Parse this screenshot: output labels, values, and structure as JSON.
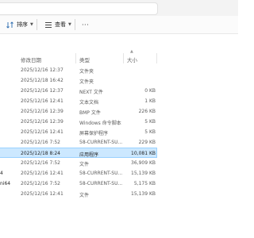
{
  "toolbar": {
    "sort_label": "排序",
    "view_label": "查看",
    "more_label": "···"
  },
  "header": {
    "date": "修改日期",
    "type": "类型",
    "size": "大小"
  },
  "rows": [
    {
      "frag": "",
      "date": "2025/12/16 12:37",
      "type": "文件夹",
      "size": ""
    },
    {
      "frag": "",
      "date": "2025/12/18 16:42",
      "type": "文件夹",
      "size": ""
    },
    {
      "frag": "",
      "date": "2025/12/16 12:37",
      "type": "NEXT 文件",
      "size": "0 KB"
    },
    {
      "frag": "",
      "date": "2025/12/16 12:41",
      "type": "文本文档",
      "size": "1 KB"
    },
    {
      "frag": "",
      "date": "2025/12/16 12:39",
      "type": "BMP 文件",
      "size": "226 KB"
    },
    {
      "frag": "",
      "date": "2025/12/16 12:39",
      "type": "Windows 命令脚本",
      "size": "5 KB"
    },
    {
      "frag": "",
      "date": "2025/12/16 12:41",
      "type": "屏幕保护程序",
      "size": "5 KB"
    },
    {
      "frag": "",
      "date": "2025/12/16 7:52",
      "type": "58-CURRENT-SU...",
      "size": "229 KB"
    },
    {
      "frag": "",
      "date": "2025/12/18 8:24",
      "type": "应用程序",
      "size": "10,081 KB",
      "selected": true
    },
    {
      "frag": "",
      "date": "2025/12/16 7:52",
      "type": "文件",
      "size": "36,909 KB"
    },
    {
      "frag": "4",
      "date": "2025/12/16 12:41",
      "type": "58-CURRENT-SU...",
      "size": "15,139 KB"
    },
    {
      "frag": "ni64",
      "date": "2025/12/16 7:52",
      "type": "58-CURRENT-SU...",
      "size": "5,175 KB"
    },
    {
      "frag": "",
      "date": "2025/12/16 12:41",
      "type": "文件",
      "size": "15,139 KB"
    }
  ]
}
